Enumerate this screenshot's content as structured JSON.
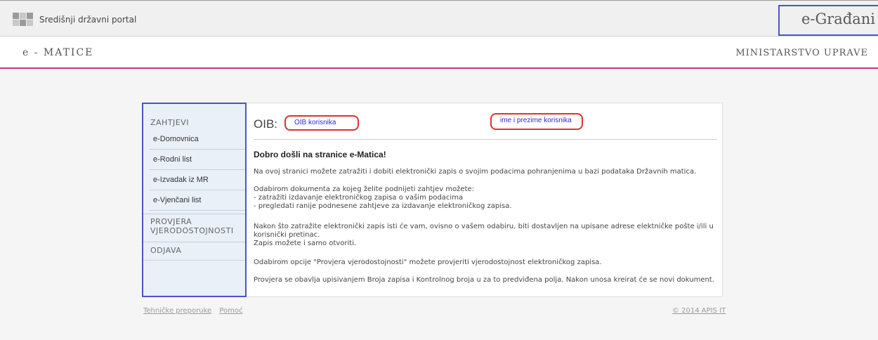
{
  "topbar": {
    "portal_name": "Središnji državni portal",
    "brand": "e-Građani"
  },
  "header": {
    "app_name": "e - MATICE",
    "ministry": "MINISTARSTVO UPRAVE"
  },
  "sidebar": {
    "section_requests": "ZAHTJEVI",
    "items": [
      {
        "label": "e-Domovnica"
      },
      {
        "label": "e-Rodni list"
      },
      {
        "label": "e-Izvadak iz MR"
      },
      {
        "label": "e-Vjenčani list"
      }
    ],
    "section_verify_line1": "PROVJERA",
    "section_verify_line2": "VJERODOSTOJNOSTI",
    "section_logout": "ODJAVA"
  },
  "content": {
    "oib_label": "OIB:",
    "oib_field": "OIB korisnika",
    "name_field": "ime i prezime korisnika",
    "welcome_title": "Dobro došli na stranice e-Matica!",
    "p1": "Na ovoj stranici možete zatražiti i dobiti elektronički zapis o svojim podacima pohranjenima u bazi podataka Državnih matica.",
    "p2_line1": "Odabirom dokumenta za kojeg želite podnijeti zahtjev možete:",
    "p2_line2": "- zatražiti izdavanje elektroničkog zapisa o vašim podacima",
    "p2_line3": "- pregledati ranije podnesene zahtjeve za izdavanje elektroničkog zapisa.",
    "p3_line1": "Nakon što zatražite elektronički zapis isti će vam, ovisno o vašem odabiru, biti dostavljen na upisane adrese elektničke pošte i/ili u",
    "p3_line2": "korisnički pretinac.",
    "p3_line3": "Zapis možete i samo otvoriti.",
    "p4": "Odabirom opcije \"Provjera vjerodostojnosti\" možete provjeriti vjerodostojnost elektroničkog zapisa.",
    "p5": "Provjera se obavlja upisivanjem Broja zapisa i Kontrolnog broja u za to predviđena polja. Nakon unosa kreirat će se novi dokument."
  },
  "footer": {
    "link_tech": "Tehničke preporuke",
    "link_help": "Pomoć",
    "copyright": "© 2014  APIS IT"
  }
}
